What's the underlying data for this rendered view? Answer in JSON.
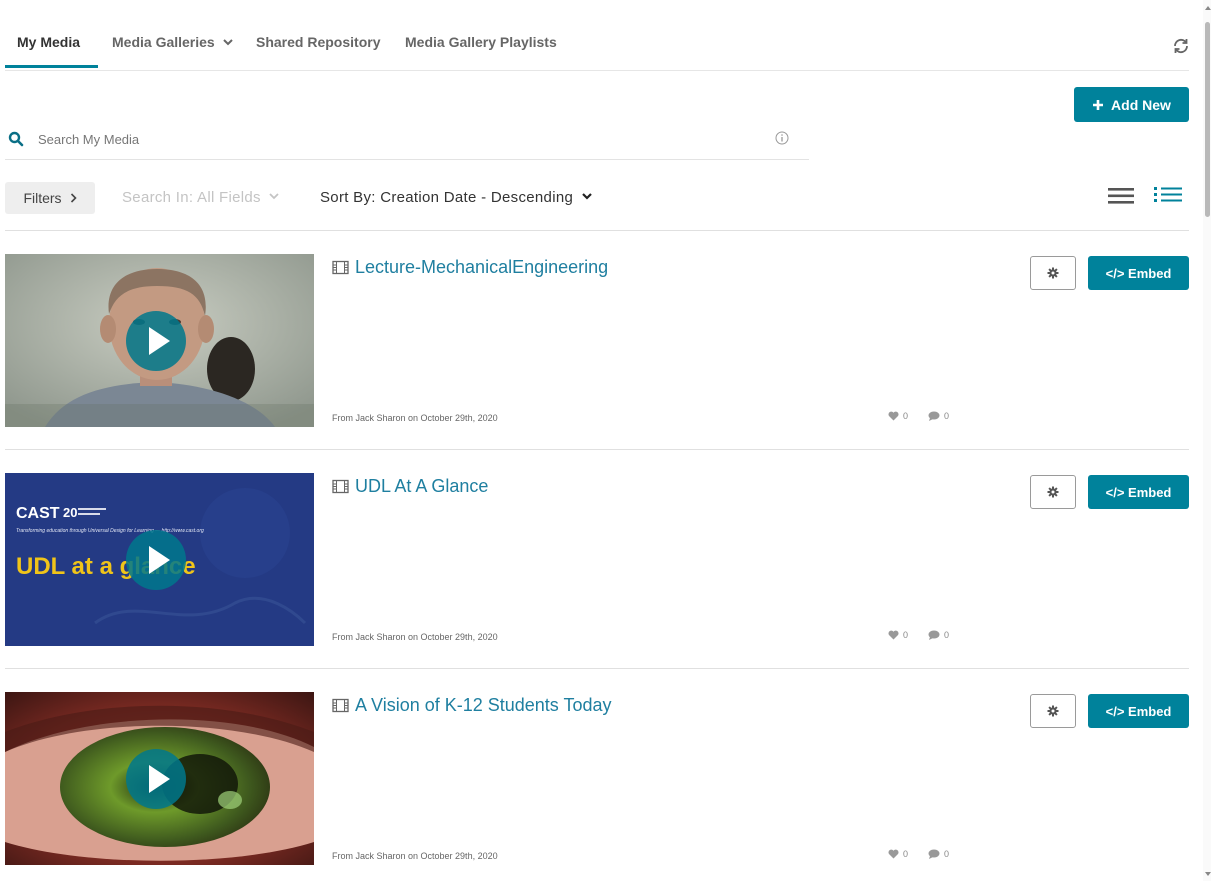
{
  "tabs": [
    {
      "label": "My Media",
      "active": true
    },
    {
      "label": "Media Galleries",
      "has_dropdown": true
    },
    {
      "label": "Shared Repository"
    },
    {
      "label": "Media Gallery Playlists"
    }
  ],
  "icons": {
    "refresh": "refresh-icon",
    "search": "search-icon",
    "info": "info-icon",
    "media_type": "film-icon",
    "gear": "gear-icon",
    "like": "heart-icon",
    "comment": "comment-icon"
  },
  "toolbar": {
    "add_new_label": "Add New",
    "search_placeholder": "Search My Media",
    "filters_label": "Filters",
    "search_in_label": "Search In: All Fields",
    "sort_by_label": "Sort By: Creation Date - Descending"
  },
  "colors": {
    "accent": "#00829b",
    "link": "#1f7fa0"
  },
  "entries": [
    {
      "title": "Lecture-MechanicalEngineering",
      "meta": "From Jack Sharon on October 29th, 2020",
      "likes": "0",
      "comments": "0",
      "embed_label": "</> Embed",
      "thumbnail": "man-portrait"
    },
    {
      "title": "UDL At A Glance",
      "meta": "From Jack Sharon on October 29th, 2020",
      "likes": "0",
      "comments": "0",
      "embed_label": "</> Embed",
      "thumbnail": "cast-udl-slide",
      "thumbnail_text": {
        "brand": "CAST",
        "tagline": "Transforming education through Universal Design for Learning — http://www.cast.org",
        "headline": "UDL at a glance"
      }
    },
    {
      "title": "A Vision of K-12 Students Today",
      "meta": "From Jack Sharon on October 29th, 2020",
      "likes": "0",
      "comments": "0",
      "embed_label": "</> Embed",
      "thumbnail": "eye-closeup"
    }
  ]
}
